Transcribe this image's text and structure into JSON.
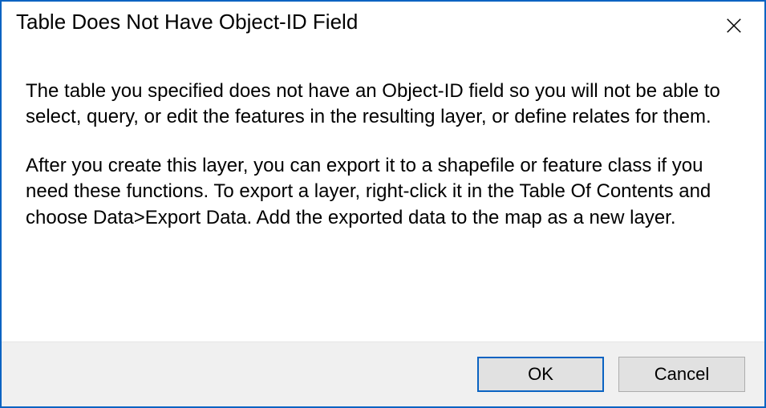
{
  "dialog": {
    "title": "Table Does Not Have Object-ID Field",
    "paragraph1": "The table you specified does not have an Object-ID field so you will not be able to select, query, or edit the features in the resulting layer, or define relates for them.",
    "paragraph2": "After you create this layer, you can export it to a shapefile or feature class if you need these functions. To export a layer, right-click it in the Table Of Contents and choose Data>Export Data. Add the exported data to the map as a new layer.",
    "ok_label": "OK",
    "cancel_label": "Cancel"
  }
}
